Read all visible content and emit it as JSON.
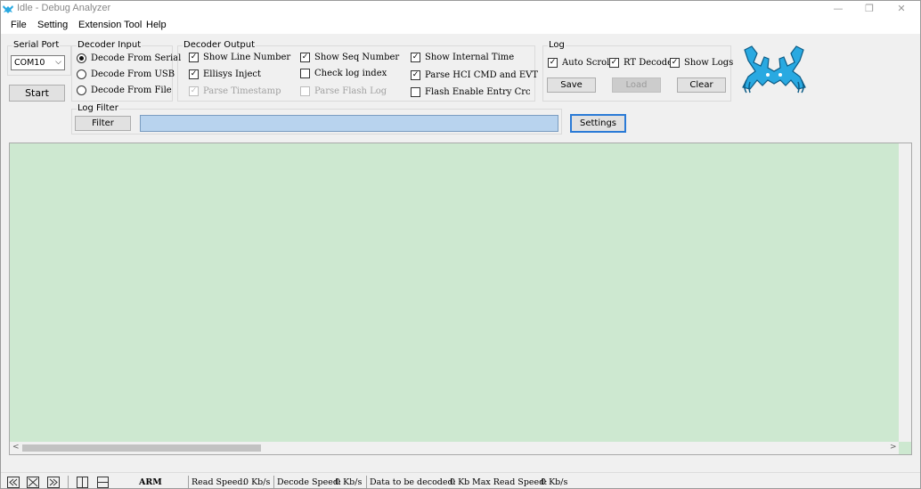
{
  "window": {
    "title": "Idle - Debug Analyzer",
    "minimize_glyph": "—",
    "restore_glyph": "❐",
    "close_glyph": "✕"
  },
  "menu": [
    "File",
    "Setting",
    "Extension Tool",
    "Help"
  ],
  "serial_port": {
    "label": "Serial Port",
    "selected": "COM10",
    "start_label": "Start"
  },
  "decoder_input": {
    "label": "Decoder Input",
    "options": [
      {
        "label": "Decode From Serial",
        "selected": true
      },
      {
        "label": "Decode From USB",
        "selected": false
      },
      {
        "label": "Decode From File",
        "selected": false
      }
    ]
  },
  "decoder_output": {
    "label": "Decoder Output",
    "options": [
      {
        "label": "Show Line Number",
        "checked": true,
        "enabled": true
      },
      {
        "label": "Ellisys Inject",
        "checked": true,
        "enabled": true
      },
      {
        "label": "Parse Timestamp",
        "checked": true,
        "enabled": false
      },
      {
        "label": "Show Seq Number",
        "checked": true,
        "enabled": true
      },
      {
        "label": "Check log index",
        "checked": false,
        "enabled": true
      },
      {
        "label": "Parse Flash Log",
        "checked": false,
        "enabled": false
      },
      {
        "label": "Show Internal Time",
        "checked": true,
        "enabled": true
      },
      {
        "label": "Parse HCI CMD and EVT",
        "checked": true,
        "enabled": true
      },
      {
        "label": "Flash Enable Entry Crc",
        "checked": false,
        "enabled": true
      }
    ]
  },
  "log": {
    "label": "Log",
    "options": [
      {
        "label": "Auto Scroll",
        "checked": true
      },
      {
        "label": "RT Decode",
        "checked": true
      },
      {
        "label": "Show Logs",
        "checked": true
      }
    ],
    "save_label": "Save",
    "load_label": "Load",
    "clear_label": "Clear"
  },
  "log_filter": {
    "label": "Log Filter",
    "filter_label": "Filter",
    "value": "",
    "settings_label": "Settings"
  },
  "colors": {
    "log_background": "#cde8d0",
    "filter_input": "#b8d3ee",
    "logo": "#29a9e1",
    "focus_border": "#2a7ad6"
  },
  "statusbar": {
    "arch": "ARM",
    "read_speed_label": "Read Speed:",
    "read_speed": "0 Kb/s",
    "decode_speed_label": "Decode Speed:",
    "decode_speed": "0 Kb/s",
    "pending_label": "Data to be decoded:",
    "pending": "0 Kb",
    "max_read_label": "Max Read Speed:",
    "max_read": "0 Kb/s"
  }
}
